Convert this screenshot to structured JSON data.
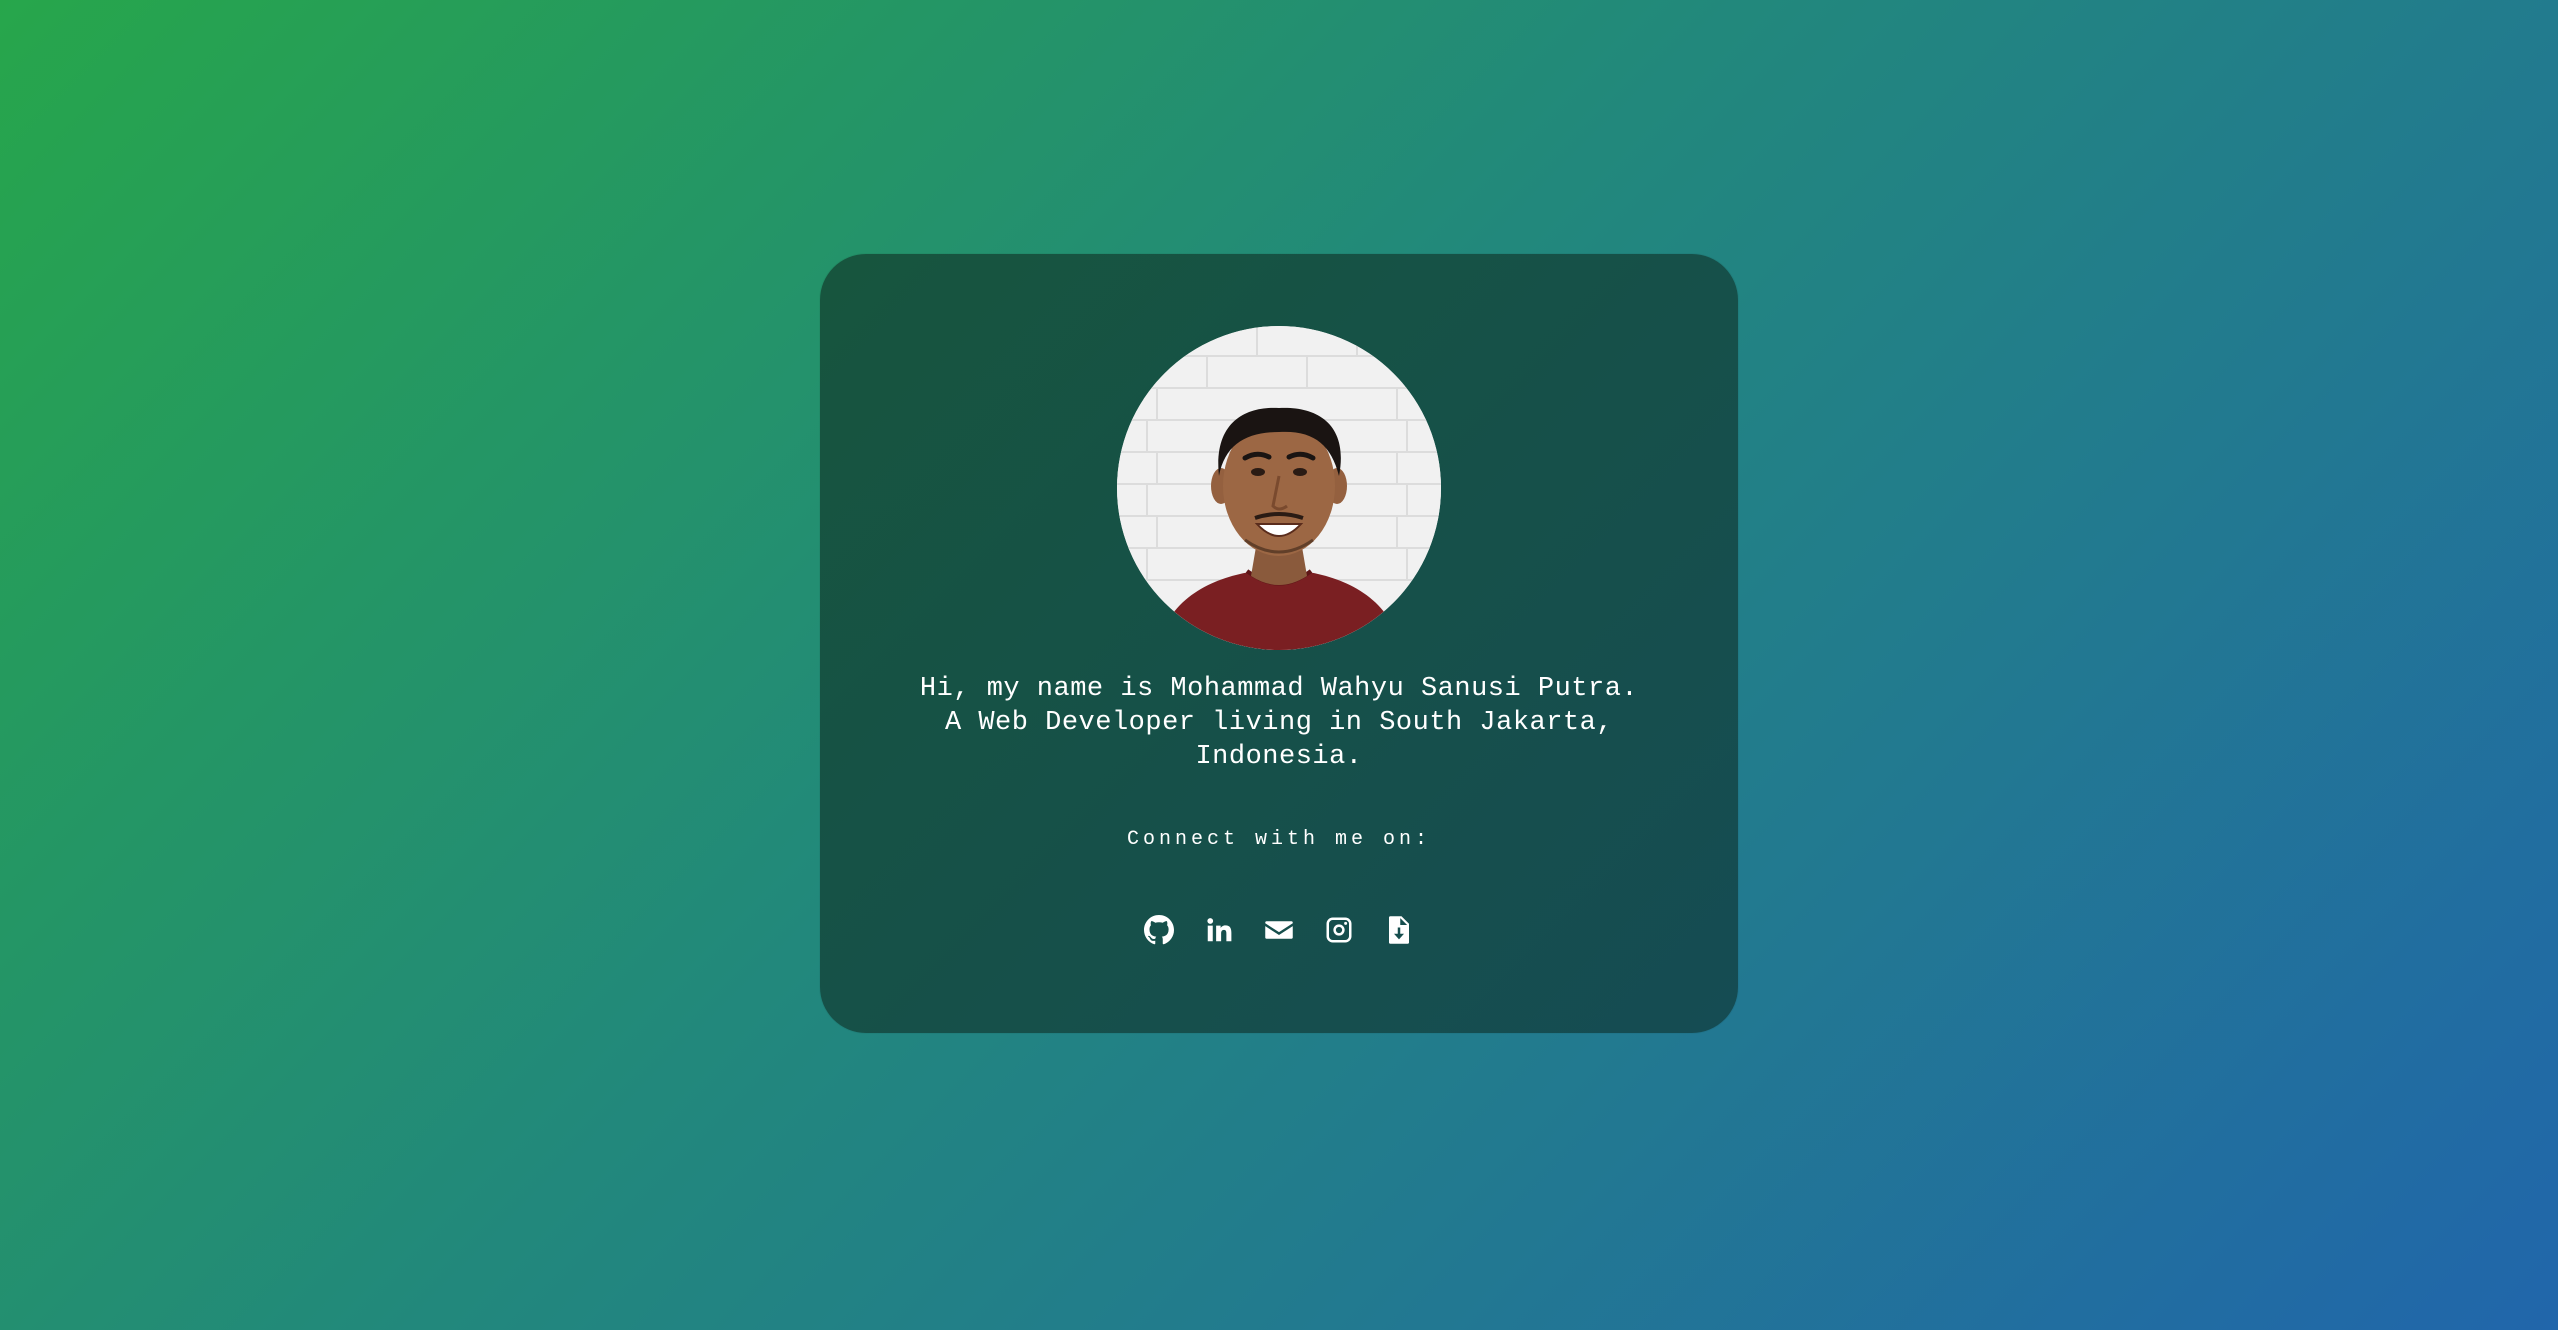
{
  "profile": {
    "bio_line1": "Hi, my name is Mohammad Wahyu Sanusi Putra.",
    "bio_line2": "A Web Developer living in South Jakarta,",
    "bio_line3": "Indonesia.",
    "connect_label": "Connect with me on:"
  },
  "social_links": [
    {
      "icon": "github-icon"
    },
    {
      "icon": "linkedin-icon"
    },
    {
      "icon": "envelope-icon"
    },
    {
      "icon": "instagram-icon"
    },
    {
      "icon": "file-download-icon"
    }
  ],
  "colors": {
    "background_start": "#27a64b",
    "background_mid": "#22887c",
    "background_end": "#2166ab",
    "card": "#16503a",
    "text": "#ffffff"
  }
}
